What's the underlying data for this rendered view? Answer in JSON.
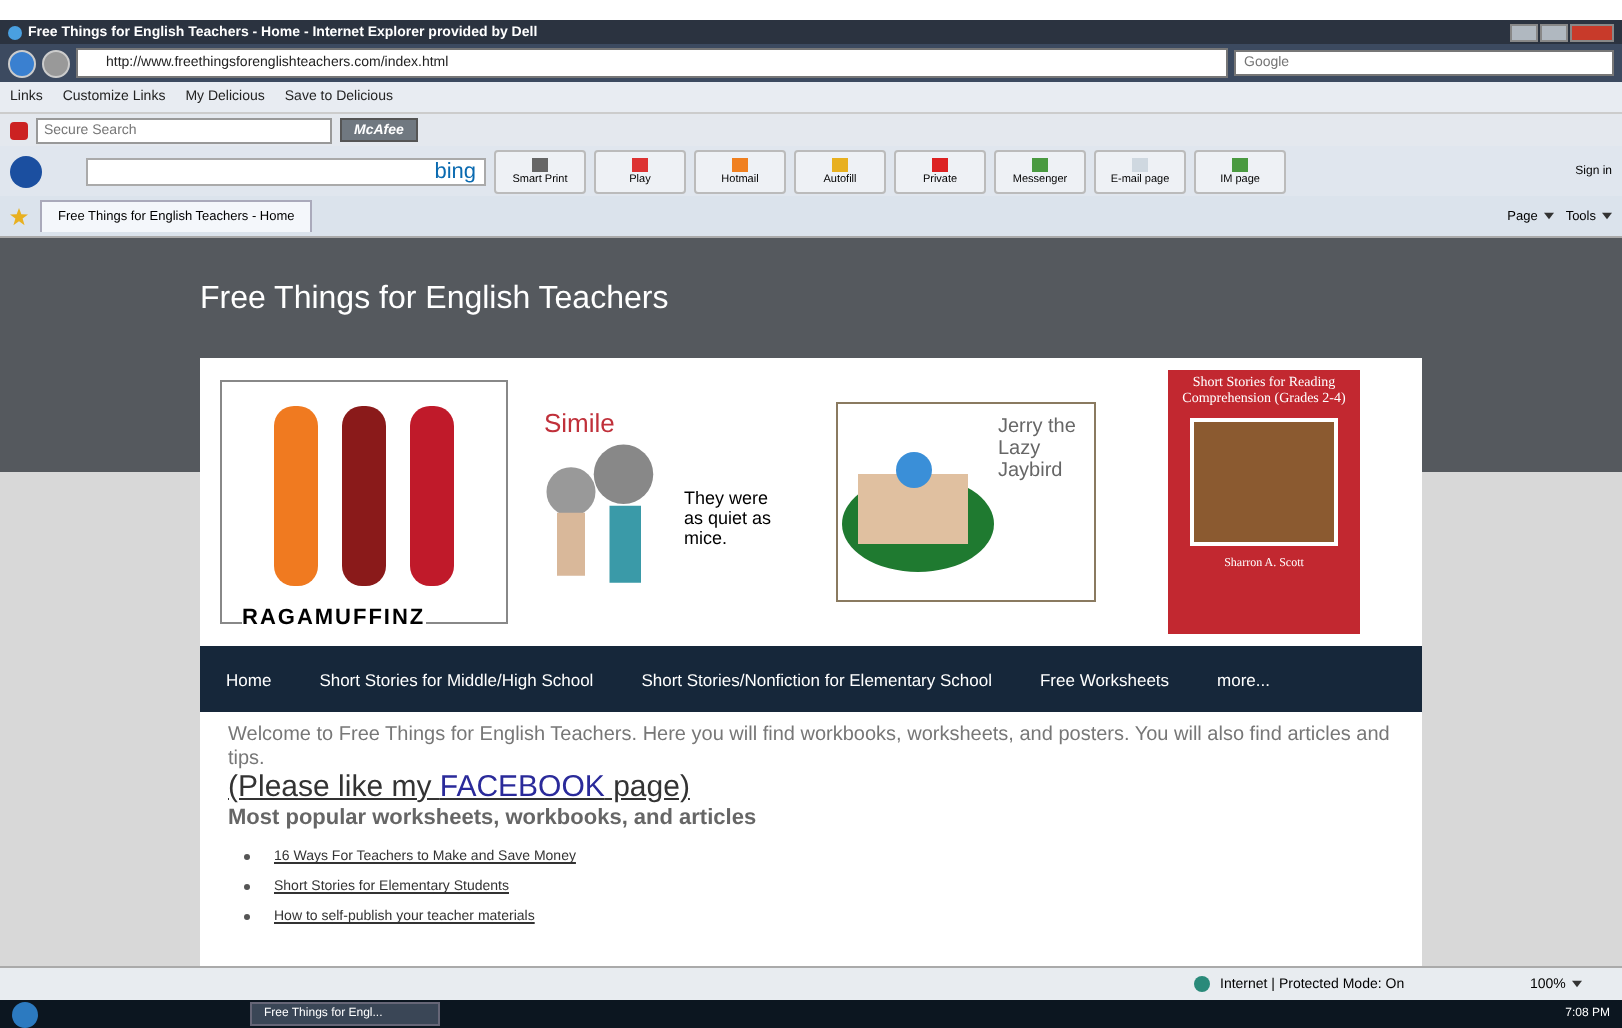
{
  "window": {
    "title": "Free Things for English Teachers - Home - Internet Explorer provided by Dell"
  },
  "address_bar": {
    "url": "http://www.freethingsforenglishteachers.com/index.html",
    "search_placeholder": "Google"
  },
  "links_bar": {
    "label": "Links",
    "items": [
      "Customize Links",
      "My Delicious",
      "Save to Delicious"
    ]
  },
  "mcafee_bar": {
    "search_placeholder": "Secure Search",
    "brand": "McAfee"
  },
  "hp_toolbar": {
    "search_brand": "bing",
    "sign_in": "Sign in",
    "buttons": [
      {
        "label": "Smart Print",
        "kind": "print"
      },
      {
        "label": "Play",
        "kind": "play"
      },
      {
        "label": "Hotmail",
        "kind": "mail"
      },
      {
        "label": "Autofill",
        "kind": "pencil"
      },
      {
        "label": "Private",
        "kind": "private"
      },
      {
        "label": "Messenger",
        "kind": "people"
      },
      {
        "label": "E-mail page",
        "kind": "envelope"
      },
      {
        "label": "IM page",
        "kind": "people"
      }
    ]
  },
  "tab_bar": {
    "tabs": [
      {
        "label": "Free Things for English Teachers - Home",
        "selected": true
      }
    ],
    "commands": [
      "Page",
      "Tools"
    ]
  },
  "page": {
    "site_title": "Free Things for English Teachers",
    "banner": {
      "ragamuffinz": "RAGAMUFFINZ",
      "simile_title": "Simile",
      "simile_text": "They were as quiet as mice.",
      "jerry": "Jerry the Lazy Jaybird",
      "book_title": "Short Stories for Reading Comprehension (Grades 2-4)",
      "book_author": "Sharron A. Scott"
    },
    "nav": [
      "Home",
      "Short Stories for Middle/High School",
      "Short Stories/Nonfiction for Elementary School",
      "Free Worksheets",
      "more..."
    ],
    "welcome": "Welcome to Free Things for English Teachers.  Here you will find workbooks, worksheets, and posters.  You will also find articles and tips.",
    "facebook": {
      "before": "(Please like my ",
      "link": "FACEBOOK",
      "after": " page)"
    },
    "heading": "Most popular worksheets, workbooks, and articles",
    "links": [
      "16 Ways For Teachers to Make and Save Money",
      "Short Stories for Elementary Students",
      "How to self-publish your teacher materials"
    ]
  },
  "status_bar": {
    "zone": "Internet | Protected Mode: On",
    "zoom": "100%"
  },
  "taskbar": {
    "window": "Free Things for Engl...",
    "time": "7:08 PM"
  }
}
